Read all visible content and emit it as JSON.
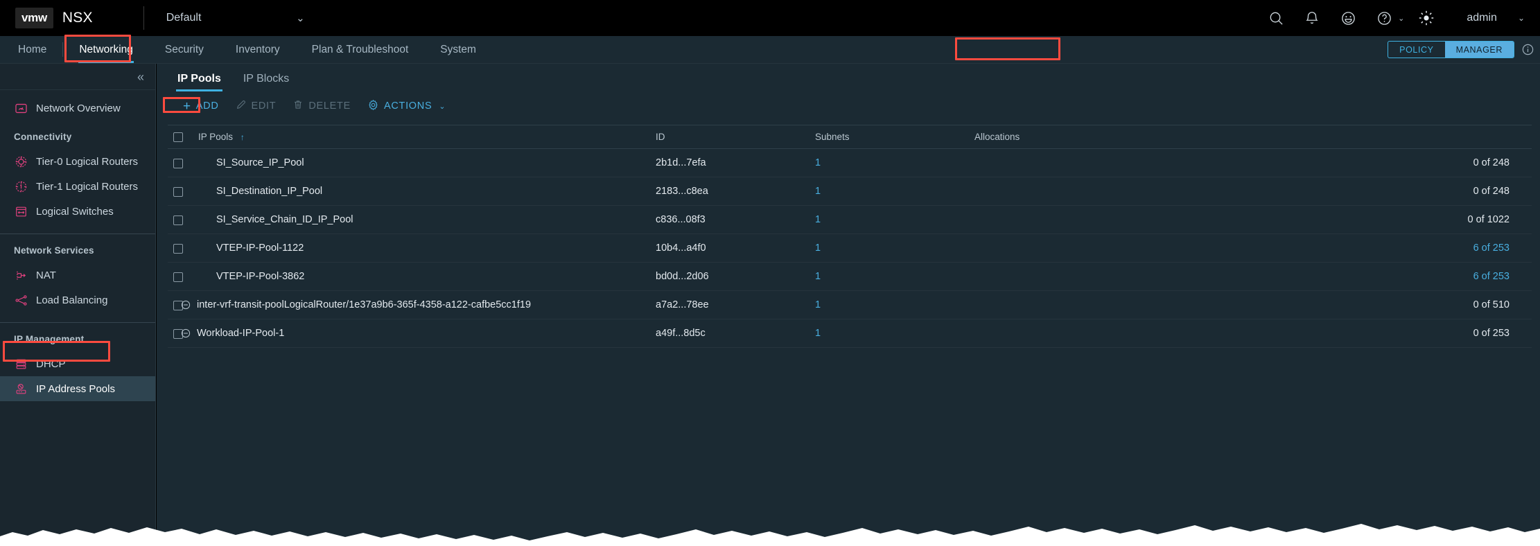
{
  "header": {
    "logo_text": "vmw",
    "product": "NSX",
    "context_selector": {
      "value": "Default",
      "chevron": "chevron-down-icon"
    },
    "icons": [
      {
        "name": "search-icon",
        "label": "Search"
      },
      {
        "name": "notification-bell-icon",
        "label": "Notifications"
      },
      {
        "name": "feedback-smiley-icon",
        "label": "Feedback"
      },
      {
        "name": "help-icon",
        "label": "Help"
      },
      {
        "name": "theme-brightness-icon",
        "label": "Theme"
      }
    ],
    "user": {
      "name": "admin",
      "chevron": "chevron-down-icon"
    }
  },
  "nav": {
    "items": [
      {
        "label": "Home",
        "active": false
      },
      {
        "label": "Networking",
        "active": true
      },
      {
        "label": "Security",
        "active": false
      },
      {
        "label": "Inventory",
        "active": false
      },
      {
        "label": "Plan & Troubleshoot",
        "active": false
      },
      {
        "label": "System",
        "active": false
      }
    ],
    "mode_toggle": {
      "policy_label": "POLICY",
      "manager_label": "MANAGER",
      "selected": "MANAGER"
    },
    "info_icon": "info-circle-icon"
  },
  "sidebar": {
    "collapse_icon": "collapse-double-chevron-left-icon",
    "overview": {
      "label": "Network Overview",
      "icon": "network-overview-icon"
    },
    "groups": [
      {
        "title": "Connectivity",
        "items": [
          {
            "label": "Tier-0 Logical Routers",
            "icon": "tier0-router-icon",
            "selected": false
          },
          {
            "label": "Tier-1 Logical Routers",
            "icon": "tier1-router-icon",
            "selected": false
          },
          {
            "label": "Logical Switches",
            "icon": "logical-switch-icon",
            "selected": false
          }
        ]
      },
      {
        "title": "Network Services",
        "items": [
          {
            "label": "NAT",
            "icon": "nat-icon",
            "selected": false
          },
          {
            "label": "Load Balancing",
            "icon": "load-balancing-icon",
            "selected": false
          }
        ]
      },
      {
        "title": "IP Management",
        "items": [
          {
            "label": "DHCP",
            "icon": "dhcp-server-icon",
            "selected": false
          },
          {
            "label": "IP Address Pools",
            "icon": "ip-address-pool-icon",
            "selected": true
          }
        ]
      }
    ]
  },
  "main": {
    "tabs": [
      {
        "label": "IP Pools",
        "active": true
      },
      {
        "label": "IP Blocks",
        "active": false
      }
    ],
    "toolbar": [
      {
        "label": "ADD",
        "icon": "plus-icon",
        "enabled": true,
        "has_chevron": false
      },
      {
        "label": "EDIT",
        "icon": "pencil-icon",
        "enabled": false,
        "has_chevron": false
      },
      {
        "label": "DELETE",
        "icon": "trash-icon",
        "enabled": false,
        "has_chevron": false
      },
      {
        "label": "ACTIONS",
        "icon": "gear-icon",
        "enabled": true,
        "has_chevron": true
      }
    ],
    "table": {
      "columns": [
        "IP Pools",
        "ID",
        "Subnets",
        "Allocations"
      ],
      "sort_column": "IP Pools",
      "sort_direction": "asc",
      "sort_arrow_glyph": "↑",
      "select_all_checked": false,
      "rows": [
        {
          "checked": false,
          "locked": false,
          "name": "SI_Source_IP_Pool",
          "id": "2b1d...7efa",
          "subnets": "1",
          "allocations": "0 of 248",
          "alloc_link": false
        },
        {
          "checked": false,
          "locked": false,
          "name": "SI_Destination_IP_Pool",
          "id": "2183...c8ea",
          "subnets": "1",
          "allocations": "0 of 248",
          "alloc_link": false
        },
        {
          "checked": false,
          "locked": false,
          "name": "SI_Service_Chain_ID_IP_Pool",
          "id": "c836...08f3",
          "subnets": "1",
          "allocations": "0 of 1022",
          "alloc_link": false
        },
        {
          "checked": false,
          "locked": false,
          "name": "VTEP-IP-Pool-1122",
          "id": "10b4...a4f0",
          "subnets": "1",
          "allocations": "6 of 253",
          "alloc_link": true
        },
        {
          "checked": false,
          "locked": false,
          "name": "VTEP-IP-Pool-3862",
          "id": "bd0d...2d06",
          "subnets": "1",
          "allocations": "6 of 253",
          "alloc_link": true
        },
        {
          "checked": false,
          "locked": true,
          "name": "inter-vrf-transit-poolLogicalRouter/1e37a9b6-365f-4358-a122-cafbe5cc1f19",
          "id": "a7a2...78ee",
          "subnets": "1",
          "allocations": "0 of 510",
          "alloc_link": false
        },
        {
          "checked": false,
          "locked": true,
          "name": "Workload-IP-Pool-1",
          "id": "a49f...8d5c",
          "subnets": "1",
          "allocations": "0 of 253",
          "alloc_link": false
        }
      ]
    }
  },
  "annotations": {
    "color": "#fc4b3f",
    "targets": [
      "Networking",
      "POLICY / MANAGER",
      "ADD",
      "IP Address Pools"
    ]
  },
  "colors": {
    "accent_blue": "#49afe0",
    "sidebar_icon_pink": "#e2417f",
    "annotation_red": "#fc4b3f",
    "header_black": "#000000",
    "nav_background": "#1b2a33",
    "sidebar_background": "#1a262e",
    "selected_row": "#2e4450"
  }
}
